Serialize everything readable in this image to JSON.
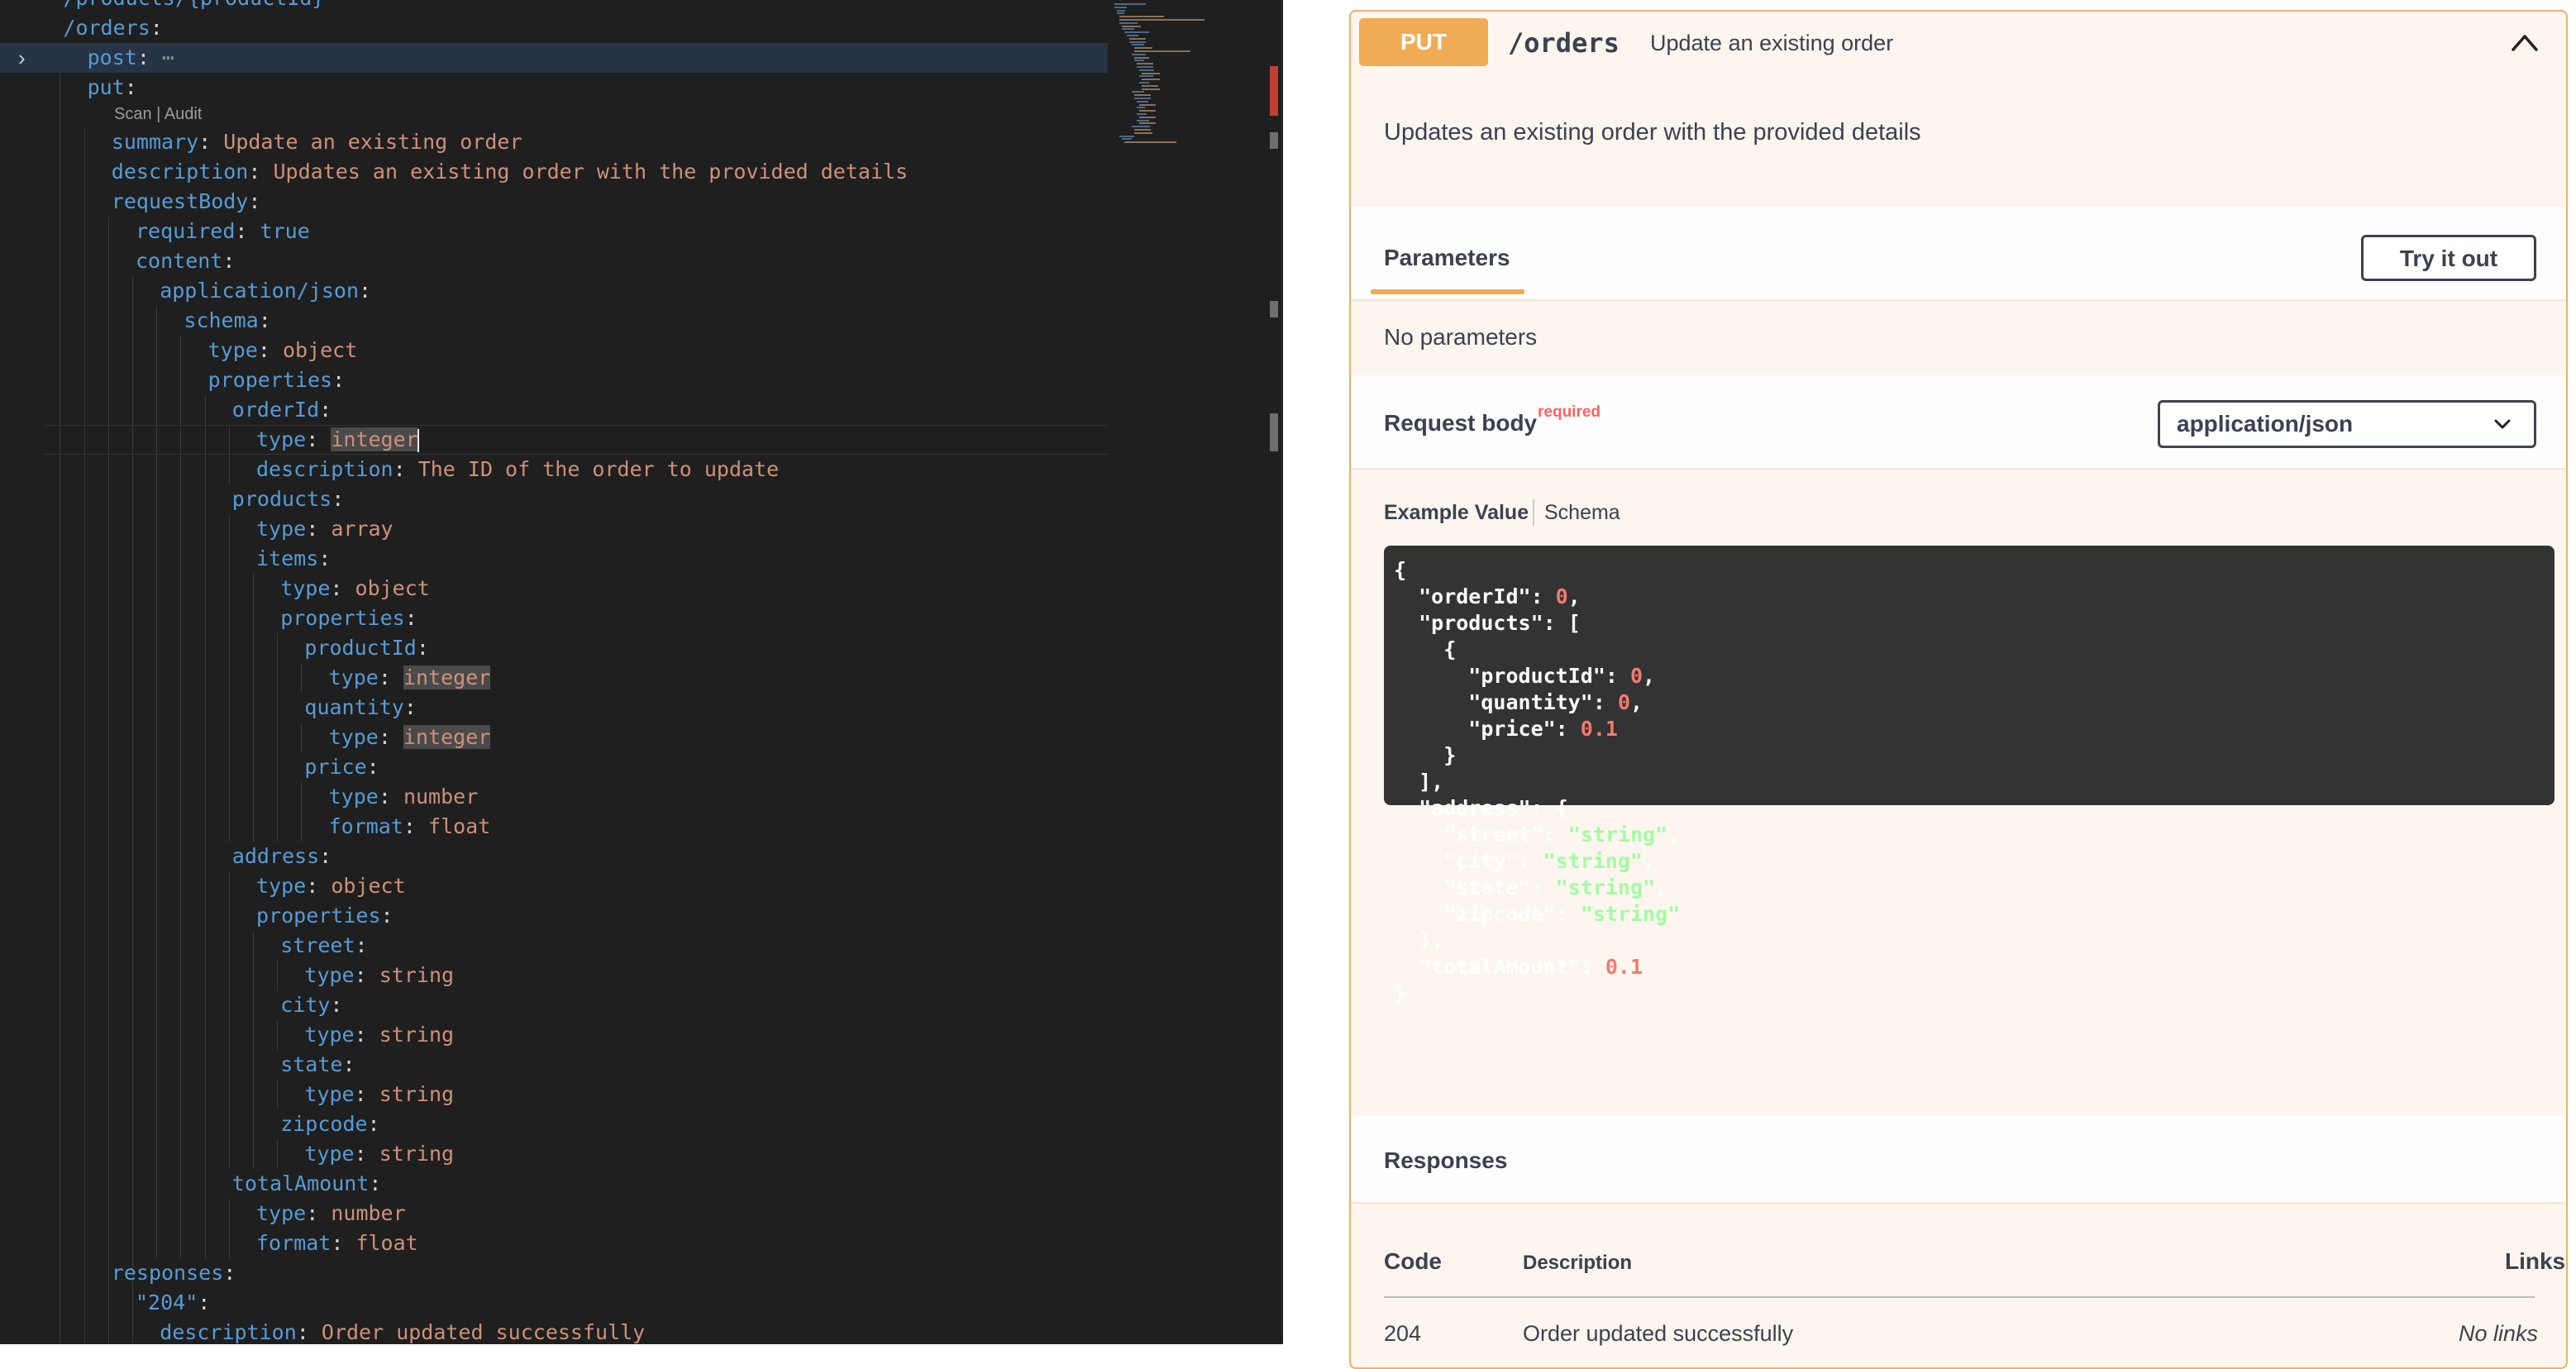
{
  "editor": {
    "codelens": "Scan | Audit",
    "lines": [
      {
        "indent": 2,
        "key": "/products/{productId}",
        "value": ""
      },
      {
        "indent": 2,
        "key": "/orders",
        "value": ""
      },
      {
        "indent": 3,
        "key": "post",
        "value": ""
      },
      {
        "indent": 3,
        "key": "put",
        "value": ""
      },
      {
        "indent": 4,
        "key": "summary",
        "value": "Update an existing order"
      },
      {
        "indent": 4,
        "key": "description",
        "value": "Updates an existing order with the provided details"
      },
      {
        "indent": 4,
        "key": "requestBody",
        "value": ""
      },
      {
        "indent": 5,
        "key": "required",
        "value": "true"
      },
      {
        "indent": 5,
        "key": "content",
        "value": ""
      },
      {
        "indent": 6,
        "key": "application/json",
        "value": ""
      },
      {
        "indent": 7,
        "key": "schema",
        "value": ""
      },
      {
        "indent": 8,
        "key": "type",
        "value": "object"
      },
      {
        "indent": 8,
        "key": "properties",
        "value": ""
      },
      {
        "indent": 9,
        "key": "orderId",
        "value": ""
      },
      {
        "indent": 10,
        "key": "type",
        "value": "integer"
      },
      {
        "indent": 10,
        "key": "description",
        "value": "The ID of the order to update"
      },
      {
        "indent": 9,
        "key": "products",
        "value": ""
      },
      {
        "indent": 10,
        "key": "type",
        "value": "array"
      },
      {
        "indent": 10,
        "key": "items",
        "value": ""
      },
      {
        "indent": 11,
        "key": "type",
        "value": "object"
      },
      {
        "indent": 11,
        "key": "properties",
        "value": ""
      },
      {
        "indent": 12,
        "key": "productId",
        "value": ""
      },
      {
        "indent": 13,
        "key": "type",
        "value": "integer"
      },
      {
        "indent": 12,
        "key": "quantity",
        "value": ""
      },
      {
        "indent": 13,
        "key": "type",
        "value": "integer"
      },
      {
        "indent": 12,
        "key": "price",
        "value": ""
      },
      {
        "indent": 13,
        "key": "type",
        "value": "number"
      },
      {
        "indent": 13,
        "key": "format",
        "value": "float"
      },
      {
        "indent": 9,
        "key": "address",
        "value": ""
      },
      {
        "indent": 10,
        "key": "type",
        "value": "object"
      },
      {
        "indent": 10,
        "key": "properties",
        "value": ""
      },
      {
        "indent": 11,
        "key": "street",
        "value": ""
      },
      {
        "indent": 12,
        "key": "type",
        "value": "string"
      },
      {
        "indent": 11,
        "key": "city",
        "value": ""
      },
      {
        "indent": 12,
        "key": "type",
        "value": "string"
      },
      {
        "indent": 11,
        "key": "state",
        "value": ""
      },
      {
        "indent": 12,
        "key": "type",
        "value": "string"
      },
      {
        "indent": 11,
        "key": "zipcode",
        "value": ""
      },
      {
        "indent": 12,
        "key": "type",
        "value": "string"
      },
      {
        "indent": 9,
        "key": "totalAmount",
        "value": ""
      },
      {
        "indent": 10,
        "key": "type",
        "value": "number"
      },
      {
        "indent": 10,
        "key": "format",
        "value": "float"
      },
      {
        "indent": 4,
        "key": "responses",
        "value": ""
      },
      {
        "indent": 5,
        "key": "\"204\"",
        "value": ""
      },
      {
        "indent": 6,
        "key": "description",
        "value": "Order updated successfully"
      }
    ]
  },
  "operation": {
    "method": "PUT",
    "path": "/orders",
    "summary": "Update an existing order",
    "description": "Updates an existing order with the provided details",
    "method_color": "#f0ac54"
  },
  "parameters": {
    "tab_label": "Parameters",
    "try_button": "Try it out",
    "empty_text": "No parameters"
  },
  "request_body": {
    "title": "Request body",
    "required_label": "required",
    "content_type": "application/json",
    "example_tab": "Example Value",
    "schema_tab": "Schema",
    "example": [
      {
        "t": "{"
      },
      {
        "t": "  \"orderId\": ",
        "n": "0",
        "e": ","
      },
      {
        "t": "  \"products\": ["
      },
      {
        "t": "    {"
      },
      {
        "t": "      \"productId\": ",
        "n": "0",
        "e": ","
      },
      {
        "t": "      \"quantity\": ",
        "n": "0",
        "e": ","
      },
      {
        "t": "      \"price\": ",
        "n": "0.1"
      },
      {
        "t": "    }"
      },
      {
        "t": "  ],"
      },
      {
        "t": "  \"address\": {"
      },
      {
        "t": "    \"street\": ",
        "s": "\"string\"",
        "e": ","
      },
      {
        "t": "    \"city\": ",
        "s": "\"string\"",
        "e": ","
      },
      {
        "t": "    \"state\": ",
        "s": "\"string\"",
        "e": ","
      },
      {
        "t": "    \"zipcode\": ",
        "s": "\"string\""
      },
      {
        "t": "  },"
      },
      {
        "t": "  \"totalAmount\": ",
        "n": "0.1"
      },
      {
        "t": "}"
      }
    ]
  },
  "responses": {
    "title": "Responses",
    "col_code": "Code",
    "col_description": "Description",
    "col_links": "Links",
    "rows": [
      {
        "code": "204",
        "description": "Order updated successfully",
        "links": "No links"
      }
    ]
  }
}
